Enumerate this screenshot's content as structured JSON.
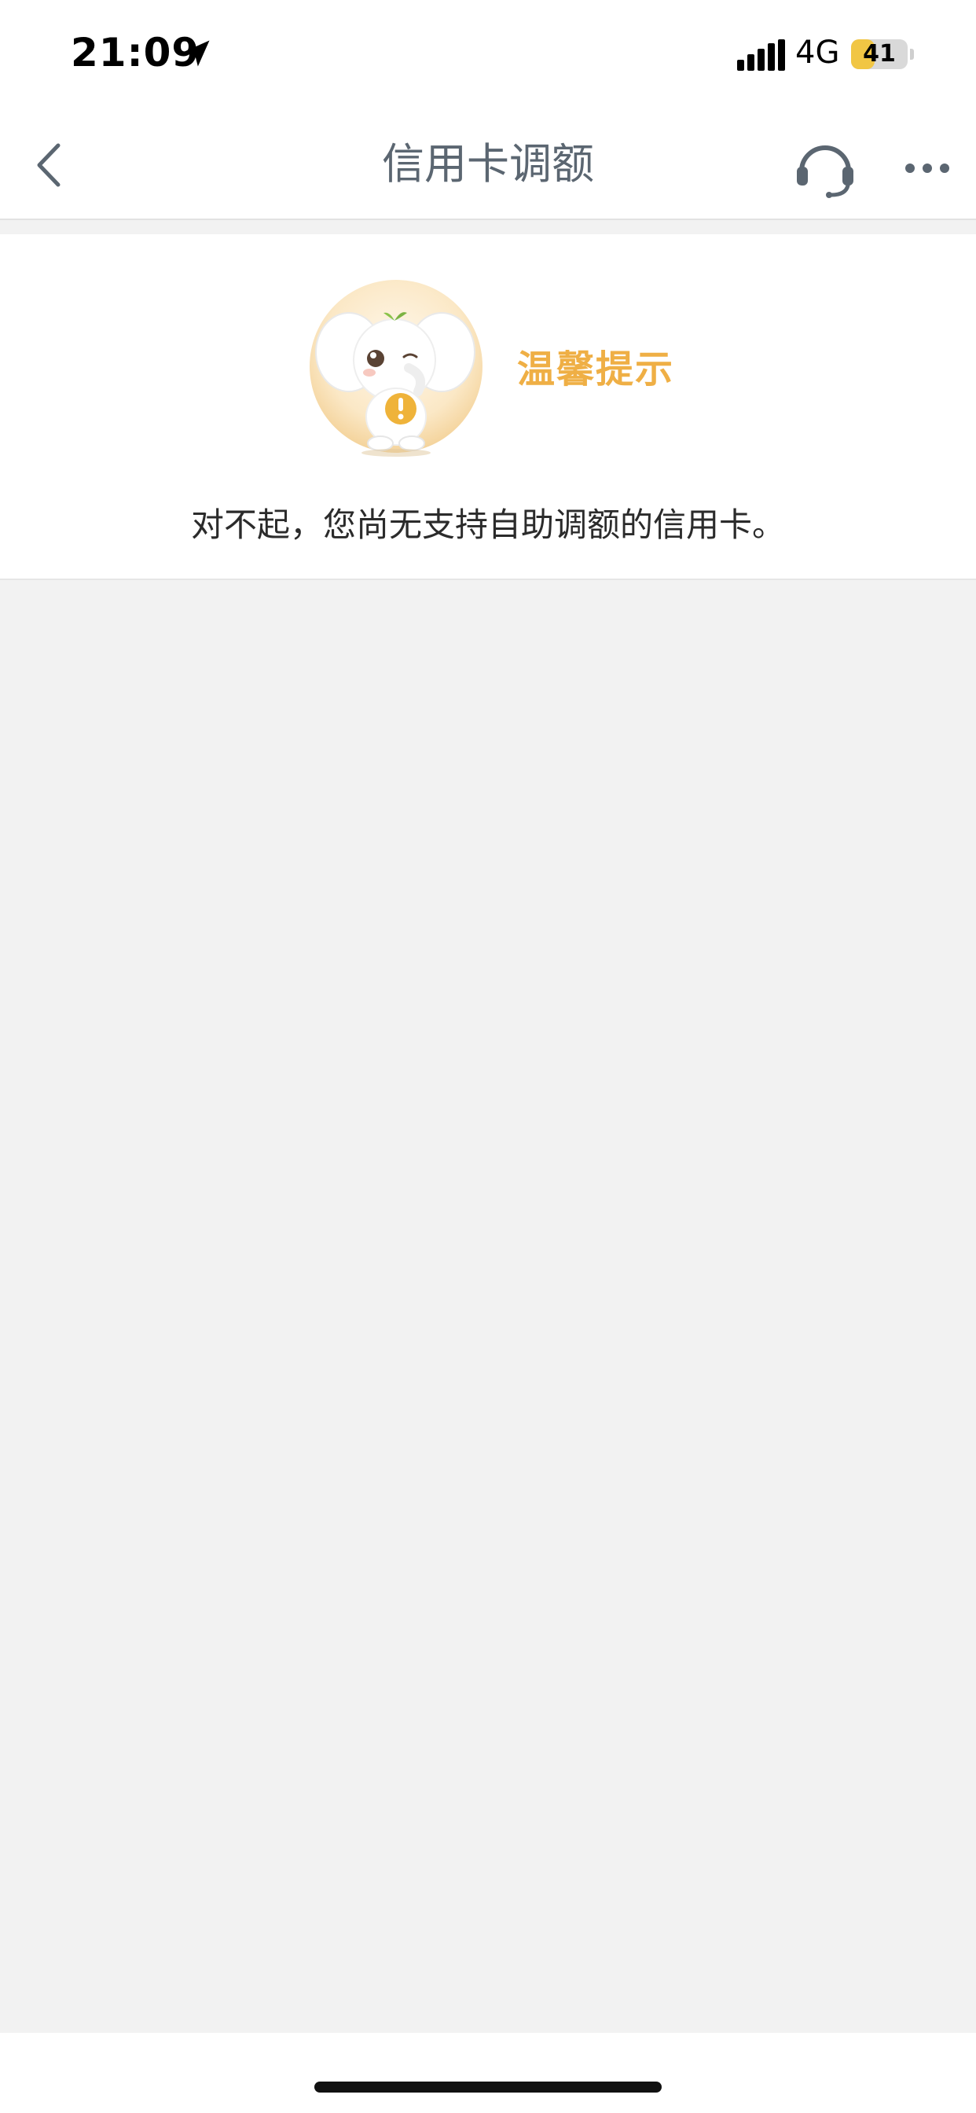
{
  "status_bar": {
    "time": "21:09",
    "network": "4G",
    "battery_level": 41,
    "battery_label": "41",
    "location_icon": "location-arrow-icon",
    "signal_icon": "signal-bars-icon"
  },
  "nav": {
    "title": "信用卡调额",
    "back_icon": "chevron-left-icon",
    "service_icon": "headset-icon",
    "more_icon": "more-dots-icon"
  },
  "notice": {
    "title": "温馨提示",
    "message": "对不起，您尚无支持自助调额的信用卡。",
    "mascot": "elephant-mascot-warning",
    "accent_color": "#efaf45"
  },
  "colors": {
    "page_background": "#f2f2f2",
    "card_background": "#ffffff",
    "nav_text": "#5b6671",
    "battery_fill": "#f1c644"
  }
}
